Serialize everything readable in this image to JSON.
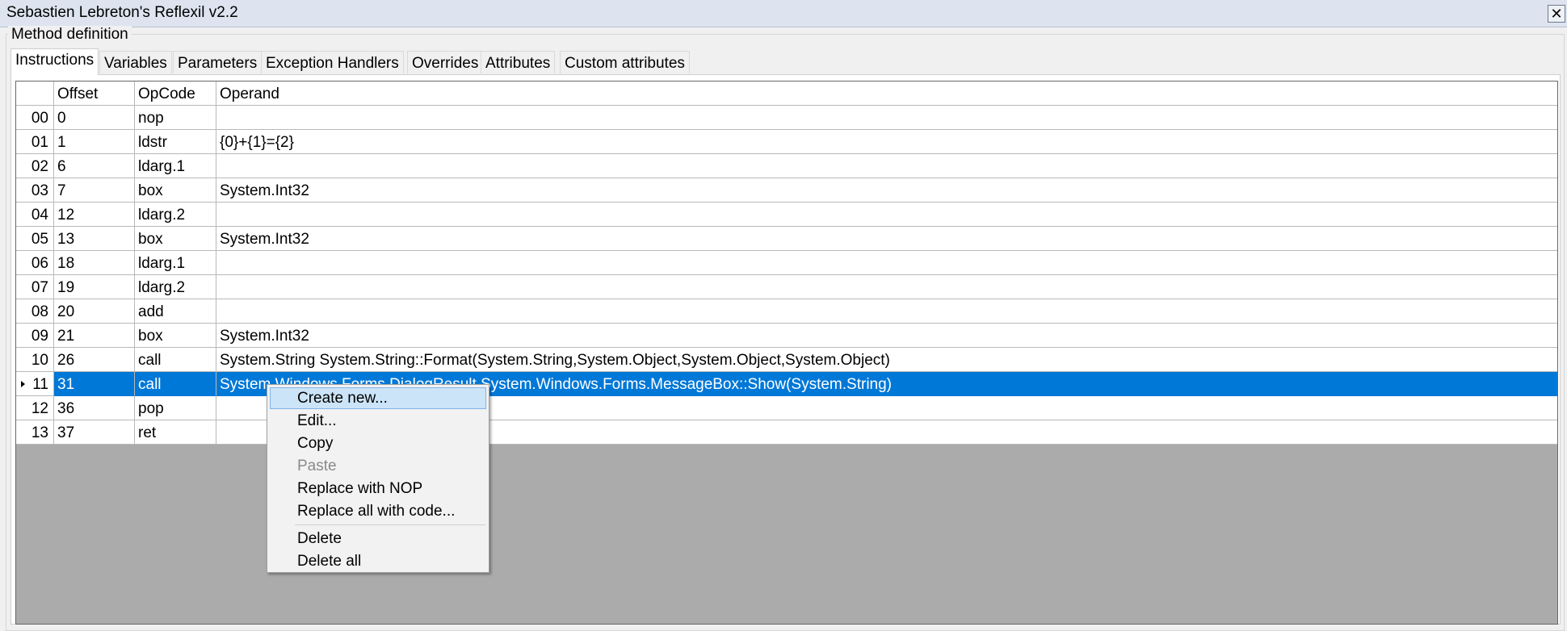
{
  "window": {
    "title": "Sebastien Lebreton's Reflexil v2.2",
    "close_icon": "close-icon"
  },
  "group": {
    "label": "Method definition"
  },
  "tabs": [
    {
      "label": "Instructions",
      "active": true
    },
    {
      "label": "Variables"
    },
    {
      "label": "Parameters"
    },
    {
      "label": "Exception Handlers"
    },
    {
      "label": "Overrides"
    },
    {
      "label": "Attributes"
    },
    {
      "label": "Custom attributes"
    }
  ],
  "grid": {
    "columns": [
      "Offset",
      "OpCode",
      "Operand"
    ],
    "selected_row": 11,
    "rows": [
      {
        "index": "00",
        "offset": "0",
        "opcode": "nop",
        "operand": ""
      },
      {
        "index": "01",
        "offset": "1",
        "opcode": "ldstr",
        "operand": "{0}+{1}={2}"
      },
      {
        "index": "02",
        "offset": "6",
        "opcode": "ldarg.1",
        "operand": ""
      },
      {
        "index": "03",
        "offset": "7",
        "opcode": "box",
        "operand": "System.Int32"
      },
      {
        "index": "04",
        "offset": "12",
        "opcode": "ldarg.2",
        "operand": ""
      },
      {
        "index": "05",
        "offset": "13",
        "opcode": "box",
        "operand": "System.Int32"
      },
      {
        "index": "06",
        "offset": "18",
        "opcode": "ldarg.1",
        "operand": ""
      },
      {
        "index": "07",
        "offset": "19",
        "opcode": "ldarg.2",
        "operand": ""
      },
      {
        "index": "08",
        "offset": "20",
        "opcode": "add",
        "operand": ""
      },
      {
        "index": "09",
        "offset": "21",
        "opcode": "box",
        "operand": "System.Int32"
      },
      {
        "index": "10",
        "offset": "26",
        "opcode": "call",
        "operand": "System.String System.String::Format(System.String,System.Object,System.Object,System.Object)"
      },
      {
        "index": "11",
        "offset": "31",
        "opcode": "call",
        "operand": "System.Windows.Forms.DialogResult System.Windows.Forms.MessageBox::Show(System.String)"
      },
      {
        "index": "12",
        "offset": "36",
        "opcode": "pop",
        "operand": ""
      },
      {
        "index": "13",
        "offset": "37",
        "opcode": "ret",
        "operand": ""
      }
    ]
  },
  "context_menu": {
    "items": [
      {
        "label": "Create new...",
        "hover": true
      },
      {
        "label": "Edit..."
      },
      {
        "label": "Copy"
      },
      {
        "label": "Paste",
        "disabled": true
      },
      {
        "label": "Replace with NOP"
      },
      {
        "label": "Replace all with code..."
      },
      {
        "label": "Delete"
      },
      {
        "label": "Delete all"
      }
    ]
  },
  "colors": {
    "selection": "#0078d7",
    "menu_hover": "#cce4f7",
    "grid_background": "#ababab"
  }
}
